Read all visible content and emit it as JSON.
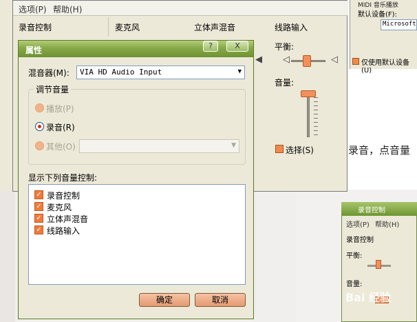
{
  "main_window": {
    "menu": {
      "options": "选项(P)",
      "help": "帮助(H)"
    },
    "columns": [
      "录音控制",
      "麦克风",
      "立体声混音",
      "线路输入"
    ],
    "balance_label": "平衡:",
    "volume_label": "音量:",
    "select_label": "选择(S)"
  },
  "midi_panel": {
    "title": "MIDI 音乐播放",
    "default_device": "默认设备(F):",
    "device_value": "Microsoft",
    "only_default": "仅使用默认设备(U)"
  },
  "article_text": "录音，点音量",
  "small_window": {
    "title": "录音控制",
    "menu_options": "选项(P)",
    "menu_help": "帮助(H)",
    "section": "录音控制",
    "balance": "平衡:",
    "volume": "音量:"
  },
  "watermark": "Bai 经验",
  "dialog": {
    "title": "属性",
    "help_btn": "?",
    "close_btn": "X",
    "mixer_label": "混音器(M):",
    "mixer_value": "VIA HD Audio Input",
    "group_label": "调节音量",
    "radios": [
      {
        "label": "播放(P)",
        "selected": false,
        "enabled": false
      },
      {
        "label": "录音(R)",
        "selected": true,
        "enabled": true
      },
      {
        "label": "其他(O)",
        "selected": false,
        "enabled": false
      }
    ],
    "show_label": "显示下列音量控制:",
    "controls": [
      "录音控制",
      "麦克风",
      "立体声混音",
      "线路输入"
    ],
    "ok": "确定",
    "cancel": "取消"
  },
  "colors": {
    "title_green": "#86a848",
    "accent_orange": "#f27b3a"
  }
}
